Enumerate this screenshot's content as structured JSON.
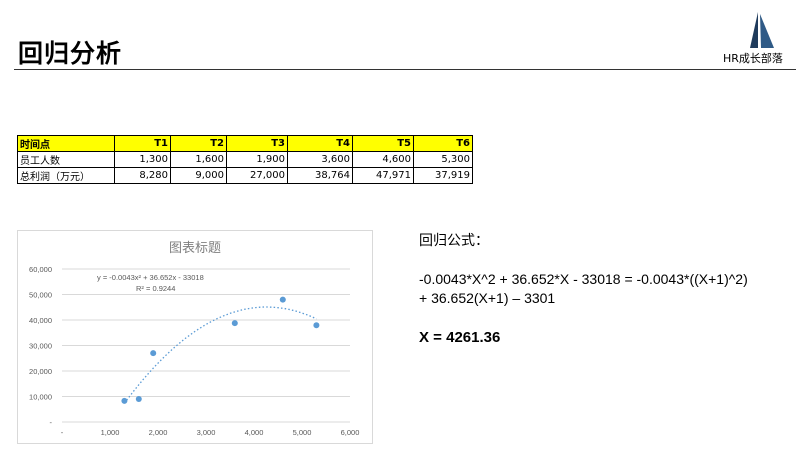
{
  "slide": {
    "title": "回归分析",
    "brand": "HR成长部落"
  },
  "table": {
    "header": [
      "时间点",
      "T1",
      "T2",
      "T3",
      "T4",
      "T5",
      "T6"
    ],
    "rows": [
      [
        "员工人数",
        "1,300",
        "1,600",
        "1,900",
        "3,600",
        "4,600",
        "5,300"
      ],
      [
        "总利润（万元）",
        "8,280",
        "9,000",
        "27,000",
        "38,764",
        "47,971",
        "37,919"
      ]
    ]
  },
  "chart_data": {
    "type": "scatter",
    "title": "图表标题",
    "x": [
      1300,
      1600,
      1900,
      3600,
      4600,
      5300
    ],
    "y": [
      8280,
      9000,
      27000,
      38764,
      47971,
      37919
    ],
    "xlim": [
      0,
      6000
    ],
    "ylim": [
      0,
      60000
    ],
    "x_ticks": [
      "-",
      "1,000",
      "2,000",
      "3,000",
      "4,000",
      "5,000",
      "6,000"
    ],
    "y_ticks": [
      "-",
      "10,000",
      "20,000",
      "30,000",
      "40,000",
      "50,000",
      "60,000"
    ],
    "trendline": {
      "type": "polynomial",
      "coefficients": [
        -0.0043,
        36.652,
        -33018
      ],
      "equation": "y = -0.0043x² + 36.652x - 33018",
      "r2": "R² = 0.9244"
    },
    "grid": true,
    "colors": {
      "points": "#5b9bd5",
      "trend": "#5b9bd5",
      "grid": "#d9d9d9"
    }
  },
  "formula": {
    "title": "回归公式：",
    "line1": "-0.0043*X^2 + 36.652*X - 33018 = -0.0043*((X+1)^2)",
    "line2": "+ 36.652(X+1) – 3301",
    "answer": "X = 4261.36"
  }
}
